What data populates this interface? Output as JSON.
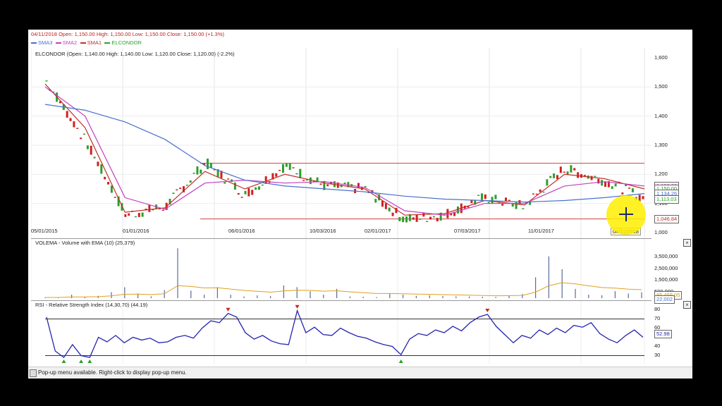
{
  "header": {
    "summary": "04/11/2018 Open: 1,150.00 High: 1,150.00 Low: 1,150.00 Close: 1,150.00 (+1.3%)",
    "legend": [
      {
        "label": "SMA3",
        "color": "#4a6fcf"
      },
      {
        "label": "SMA2",
        "color": "#c040c0"
      },
      {
        "label": "SMA1",
        "color": "#c0302a"
      },
      {
        "label": "ELCONDOR",
        "color": "#2aa02a"
      }
    ]
  },
  "price_pane": {
    "title": "ELCONDOR (Open: 1,140.00 High: 1,140.00 Low: 1,120.00 Close: 1,120.00) (-2.2%)",
    "y_ticks": [
      "1,600",
      "1,500",
      "1,400",
      "1,300",
      "1,200",
      "1,100",
      "1,000"
    ],
    "value_boxes": [
      "1,159.82",
      "1,150.00",
      "1,134.26",
      "1,113.03",
      "1,046.84"
    ],
    "x_ticks": [
      "05/01/2015",
      "01/01/2016",
      "06/01/2016",
      "10/03/2016",
      "02/01/2017",
      "07/03/2017",
      "11/01/2017",
      "04/11/2018"
    ]
  },
  "volume_pane": {
    "title": "VOLEMA - Volume with EMA (10) (25,379)",
    "y_ticks": [
      "3,500,000",
      "2,500,000",
      "1,500,000",
      "500,000"
    ],
    "value_boxes": [
      "85,459.05",
      "22,002"
    ]
  },
  "rsi_pane": {
    "title": "RSI - Relative Strength Index (14,30,70) (44.19)",
    "y_ticks": [
      "80",
      "70",
      "60",
      "50",
      "40",
      "30"
    ],
    "value_box": "52.98"
  },
  "status_bar": {
    "text": "Pop-up menu available. Right-click to display pop-up menu."
  },
  "colors": {
    "sma3": "#4a6fcf",
    "sma2": "#c040c0",
    "sma1": "#c0302a",
    "up_candle": "#2aa02a",
    "down_candle": "#d02020",
    "rsi_line": "#2424b0",
    "ema_line": "#e0a020",
    "highlight": "#ffee00"
  },
  "chart_data": [
    {
      "type": "line",
      "title": "ELCONDOR",
      "x": [
        "05/01/2015",
        "09/01/2015",
        "01/01/2016",
        "03/01/2016",
        "06/01/2016",
        "08/01/2016",
        "10/03/2016",
        "12/01/2016",
        "02/01/2017",
        "05/01/2017",
        "07/03/2017",
        "09/01/2017",
        "11/01/2017",
        "01/02/2018",
        "03/01/2018",
        "04/11/2018"
      ],
      "series": [
        {
          "name": "ELCONDOR",
          "values": [
            1520,
            1310,
            1060,
            1090,
            1240,
            1130,
            1230,
            1160,
            1150,
            1045,
            1060,
            1120,
            1090,
            1220,
            1180,
            1120
          ]
        },
        {
          "name": "SMA1",
          "values": [
            1510,
            1360,
            1070,
            1085,
            1210,
            1150,
            1200,
            1170,
            1150,
            1060,
            1065,
            1110,
            1095,
            1200,
            1185,
            1150
          ]
        },
        {
          "name": "SMA2",
          "values": [
            1500,
            1400,
            1120,
            1080,
            1170,
            1180,
            1170,
            1175,
            1155,
            1075,
            1060,
            1100,
            1100,
            1160,
            1175,
            1160
          ]
        },
        {
          "name": "SMA3",
          "values": [
            1440,
            1420,
            1380,
            1320,
            1230,
            1180,
            1160,
            1150,
            1140,
            1125,
            1115,
            1110,
            1105,
            1110,
            1120,
            1134
          ]
        }
      ],
      "ylim": [
        1000,
        1600
      ],
      "horizontal_lines": [
        1238,
        1046.84
      ]
    },
    {
      "type": "bar",
      "title": "VOLEMA - Volume with EMA (10) (25,379)",
      "values": [
        60000,
        80000,
        300000,
        120000,
        200000,
        520000,
        950000,
        400000,
        150000,
        700000,
        4300000,
        650000,
        300000,
        950000,
        300000,
        150000,
        240000,
        180000,
        1100000,
        950000,
        600000,
        300000,
        800000,
        150000,
        120000,
        90000,
        400000,
        300000,
        200000,
        250000,
        180000,
        160000,
        150000,
        120000,
        100000,
        220000,
        350000,
        1800000,
        3600000,
        2500000,
        800000,
        300000,
        250000,
        600000,
        400000,
        500000
      ],
      "ylim": [
        0,
        4500000
      ]
    },
    {
      "type": "line",
      "title": "RSI - Relative Strength Index (14,30,70) (44.19)",
      "series": [
        {
          "name": "RSI",
          "values": [
            72,
            35,
            28,
            42,
            30,
            28,
            50,
            45,
            52,
            44,
            50,
            47,
            49,
            44,
            45,
            50,
            52,
            49,
            60,
            68,
            66,
            76,
            72,
            55,
            48,
            52,
            46,
            43,
            42,
            79,
            55,
            61,
            53,
            52,
            60,
            55,
            51,
            49,
            45,
            42,
            40,
            31,
            48,
            54,
            52,
            58,
            55,
            62,
            57,
            66,
            72,
            75,
            62,
            53,
            44,
            52,
            49,
            58,
            53,
            60,
            55,
            63,
            61,
            66,
            54,
            48,
            44,
            52,
            58,
            50
          ]
        }
      ],
      "ylim": [
        25,
        85
      ],
      "overbought": 70,
      "oversold": 30
    }
  ]
}
